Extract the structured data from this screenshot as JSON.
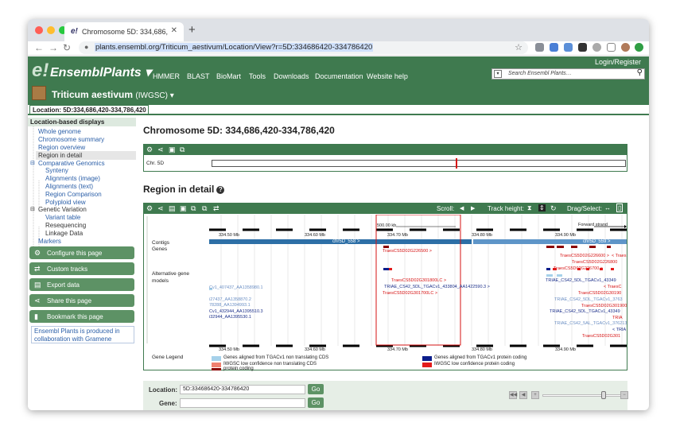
{
  "browser": {
    "tab_title": "Chromosome 5D: 334,686,420-334,786,420",
    "tab_favicon": "e!",
    "url": "plants.ensembl.org/Triticum_aestivum/Location/View?r=5D:334686420-334786420",
    "new_tab": "+",
    "back": "←",
    "forward": "→",
    "reload": "↻"
  },
  "header": {
    "logo_e": "e!",
    "logo_text": "EnsemblPlants ▾",
    "nav": [
      "HMMER",
      "BLAST",
      "BioMart",
      "Tools",
      "Downloads",
      "Documentation",
      "Website help"
    ],
    "login": "Login/Register",
    "search_placeholder": "Search Ensembl Plants…",
    "species_name": "Triticum aestivum",
    "species_assembly": "(IWGSC) ▾",
    "location_tab": "Location: 5D:334,686,420-334,786,420"
  },
  "sidebar": {
    "heading": "Location-based displays",
    "items": [
      {
        "label": "Whole genome"
      },
      {
        "label": "Chromosome summary"
      },
      {
        "label": "Region overview"
      },
      {
        "label": "Region in detail"
      },
      {
        "label": "Comparative Genomics"
      },
      {
        "label": "Synteny"
      },
      {
        "label": "Alignments (image)"
      },
      {
        "label": "Alignments (text)"
      },
      {
        "label": "Region Comparison"
      },
      {
        "label": "Polyploid view"
      },
      {
        "label": "Genetic Variation"
      },
      {
        "label": "Variant table"
      },
      {
        "label": "Resequencing"
      },
      {
        "label": "Linkage Data"
      },
      {
        "label": "Markers"
      }
    ],
    "buttons": [
      "Configure this page",
      "Custom tracks",
      "Export data",
      "Share this page",
      "Bookmark this page"
    ],
    "note": "Ensembl Plants is produced in collaboration with Gramene"
  },
  "main": {
    "title": "Chromosome 5D: 334,686,420-334,786,420",
    "chr_label": "Chr. 5D",
    "region_title": "Region in detail",
    "help": "?",
    "scroll_label": "Scroll:",
    "track_height_label": "Track height:",
    "drag_label": "Drag/Select:",
    "scale_label": "500.00 kb",
    "strand_label": "Forward strand",
    "ticks": [
      "334.50 Mb",
      "334.60 Mb",
      "334.70 Mb",
      "334.80 Mb",
      "334.90 Mb"
    ],
    "track_labels": {
      "contigs": "Contigs",
      "genes": "Genes",
      "alt_models": "Alternative gene models",
      "gene_legend": "Gene Legend"
    },
    "contig_left": "chr5D_558 >",
    "contig_right": "chr5D_559 >",
    "genes": {
      "g1": "TraesCS5D02G226500 >",
      "g2": "TraesCS5D02G226600 >",
      "g3": "< Traes",
      "g4": "TraesCS5D02G226800",
      "g5": "TraesCS5D02G226700 >",
      "a1": "TraesCS5D02G301800LC >",
      "a2": "TRIAE_CS42_5DL_TGACv1_433804_AA1422590.3 >",
      "a3": "TraesCS5D02G301700LC >",
      "a4": "TRIAE_CS42_5DL_TGACv1_43349",
      "a5": "< TraesC",
      "a6": "TraesCS5D02G30190",
      "a7": "TRIAE_CS42_5DL_TGACv1_43349",
      "a8": "< TRIA",
      "a9": "TraesCS5D02G301",
      "l1": "Cv1_407437_AA1358980.1",
      "l2": "i27437_AA1358870.2",
      "l3": "78288_AA1394993.1",
      "l4": "Cv1_432944_AA1395510.3",
      "l5": "i32944_AA1395530.1",
      "r1": "TRIAE_CS42_5DL_TGACv1_3763",
      "r2": "TRIAE_CS42_5AL_TGACv1_376213",
      "r3": "TraesCS5D02G301900",
      "r4": "TRIA"
    },
    "legend": [
      {
        "label": "Genes aligned from TGACv1 non translating CDS",
        "color": "#a6d1ea"
      },
      {
        "label": "Genes aligned from TGACv1 protein coding",
        "color": "#0b1e8b"
      },
      {
        "label": "IWGSC low confidence non translating CDS",
        "color": "#f08070"
      },
      {
        "label": "IWGSC low confidence protein coding",
        "color": "#e31b1b"
      },
      {
        "label": "protein coding",
        "color": "#8b0000"
      }
    ]
  },
  "form": {
    "location_label": "Location:",
    "location_value": "5D:334686420-334786420",
    "gene_label": "Gene:",
    "go": "Go"
  },
  "colors": {
    "brand_green": "#3f7a4f",
    "button_green": "#5d9265",
    "contig_blue": "#2d6fa6"
  }
}
